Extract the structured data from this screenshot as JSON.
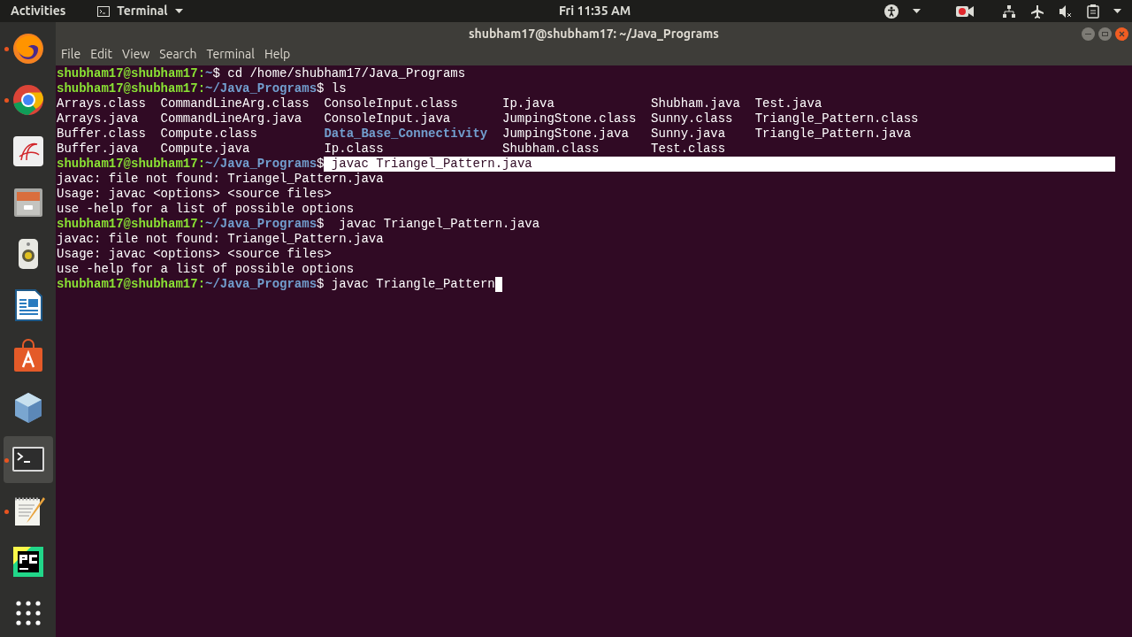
{
  "top_bar": {
    "activities": "Activities",
    "app_menu": "Terminal",
    "clock": "Fri 11:35 AM"
  },
  "dock": [
    {
      "kind": "firefox",
      "running": true,
      "selected": false
    },
    {
      "kind": "chrome",
      "running": true,
      "selected": false
    },
    {
      "kind": "pdf",
      "running": false,
      "selected": false
    },
    {
      "kind": "files",
      "running": false,
      "selected": false
    },
    {
      "kind": "speaker",
      "running": false,
      "selected": false
    },
    {
      "kind": "writer",
      "running": false,
      "selected": false
    },
    {
      "kind": "store",
      "running": false,
      "selected": false
    },
    {
      "kind": "cube",
      "running": false,
      "selected": false
    },
    {
      "kind": "terminal",
      "running": true,
      "selected": true
    },
    {
      "kind": "editor",
      "running": true,
      "selected": false
    },
    {
      "kind": "pycharm",
      "running": false,
      "selected": false
    },
    {
      "kind": "grid",
      "running": false,
      "selected": false
    }
  ],
  "window": {
    "title": "shubham17@shubham17: ~/Java_Programs",
    "menu": [
      "File",
      "Edit",
      "View",
      "Search",
      "Terminal",
      "Help"
    ]
  },
  "lines": [
    {
      "kind": "prompt",
      "user": "shubham17@shubham17:",
      "path": "~",
      "symbol": "$",
      "command": " cd /home/shubham17/Java_Programs",
      "selected": false,
      "cursor": false
    },
    {
      "kind": "prompt",
      "user": "shubham17@shubham17:",
      "path": "~/Java_Programs",
      "symbol": "$",
      "command": " ls",
      "selected": false,
      "cursor": false
    },
    {
      "kind": "listing",
      "rows": [
        [
          {
            "name": "Arrays.class",
            "dir": false
          },
          {
            "name": "CommandLineArg.class",
            "dir": false
          },
          {
            "name": "ConsoleInput.class",
            "dir": false
          },
          {
            "name": "Ip.java",
            "dir": false
          },
          {
            "name": "Shubham.java",
            "dir": false
          },
          {
            "name": "Test.java",
            "dir": false
          }
        ],
        [
          {
            "name": "Arrays.java",
            "dir": false
          },
          {
            "name": "CommandLineArg.java",
            "dir": false
          },
          {
            "name": "ConsoleInput.java",
            "dir": false
          },
          {
            "name": "JumpingStone.class",
            "dir": false
          },
          {
            "name": "Sunny.class",
            "dir": false
          },
          {
            "name": "Triangle_Pattern.class",
            "dir": false
          }
        ],
        [
          {
            "name": "Buffer.class",
            "dir": false
          },
          {
            "name": "Compute.class",
            "dir": false
          },
          {
            "name": "Data_Base_Connectivity",
            "dir": true
          },
          {
            "name": "JumpingStone.java",
            "dir": false
          },
          {
            "name": "Sunny.java",
            "dir": false
          },
          {
            "name": "Triangle_Pattern.java",
            "dir": false
          }
        ],
        [
          {
            "name": "Buffer.java",
            "dir": false
          },
          {
            "name": "Compute.java",
            "dir": false
          },
          {
            "name": "Ip.class",
            "dir": false
          },
          {
            "name": "Shubham.class",
            "dir": false
          },
          {
            "name": "Test.class",
            "dir": false
          }
        ]
      ]
    },
    {
      "kind": "prompt",
      "user": "shubham17@shubham17:",
      "path": "~/Java_Programs",
      "symbol": "$",
      "command": " javac Triangel_Pattern.java",
      "selected": true,
      "cursor": false
    },
    {
      "kind": "output",
      "text": "javac: file not found: Triangel_Pattern.java"
    },
    {
      "kind": "output",
      "text": "Usage: javac <options> <source files>"
    },
    {
      "kind": "output",
      "text": "use -help for a list of possible options"
    },
    {
      "kind": "prompt",
      "user": "shubham17@shubham17:",
      "path": "~/Java_Programs",
      "symbol": "$",
      "command": "  javac Triangel_Pattern.java",
      "selected": false,
      "cursor": false
    },
    {
      "kind": "output",
      "text": "javac: file not found: Triangel_Pattern.java"
    },
    {
      "kind": "output",
      "text": "Usage: javac <options> <source files>"
    },
    {
      "kind": "output",
      "text": "use -help for a list of possible options"
    },
    {
      "kind": "prompt",
      "user": "shubham17@shubham17:",
      "path": "~/Java_Programs",
      "symbol": "$",
      "command": " javac Triangle_Pattern",
      "selected": false,
      "cursor": true
    }
  ]
}
